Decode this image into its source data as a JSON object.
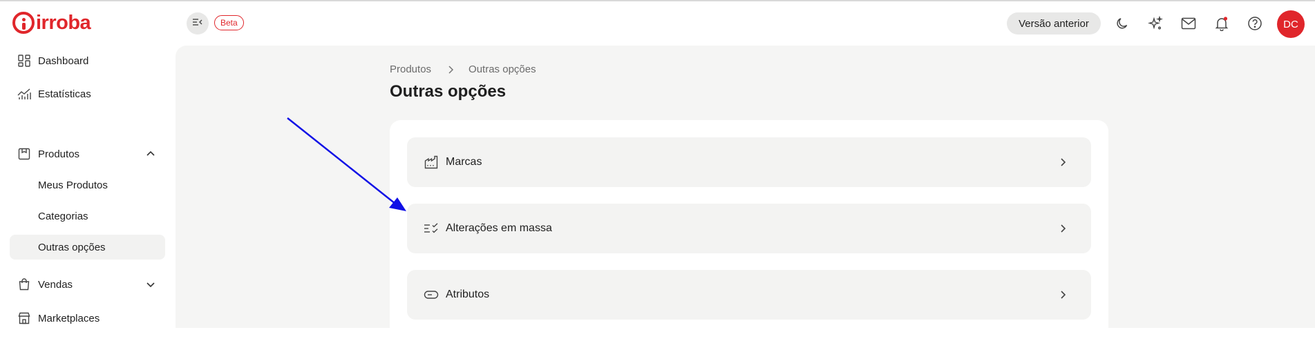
{
  "brand": {
    "name": "irroba",
    "color": "#e0262b"
  },
  "sidebar": {
    "items": [
      {
        "label": "Dashboard",
        "icon": "dashboard-grid-icon"
      },
      {
        "label": "Estatísticas",
        "icon": "statistics-chart-icon"
      },
      {
        "label": "Produtos",
        "icon": "products-box-icon",
        "expanded": true,
        "children": [
          {
            "label": "Meus Produtos"
          },
          {
            "label": "Categorias"
          },
          {
            "label": "Outras opções",
            "active": true
          }
        ]
      },
      {
        "label": "Vendas",
        "icon": "sales-bag-icon",
        "expanded": false
      },
      {
        "label": "Marketplaces",
        "icon": "marketplace-store-icon"
      }
    ]
  },
  "header": {
    "beta_label": "Beta",
    "previous_version_label": "Versão anterior",
    "avatar_initials": "DC",
    "icons": [
      "moon-icon",
      "sparkle-icon",
      "mail-icon",
      "bell-icon",
      "help-icon"
    ]
  },
  "main": {
    "breadcrumb": [
      "Produtos",
      "Outras opções"
    ],
    "title": "Outras opções",
    "options": [
      {
        "label": "Marcas",
        "icon": "factory-icon"
      },
      {
        "label": "Alterações em massa",
        "icon": "bulk-edit-checklist-icon"
      },
      {
        "label": "Atributos",
        "icon": "tag-attribute-icon"
      }
    ]
  },
  "annotation": {
    "arrow_color": "#1010e6"
  }
}
